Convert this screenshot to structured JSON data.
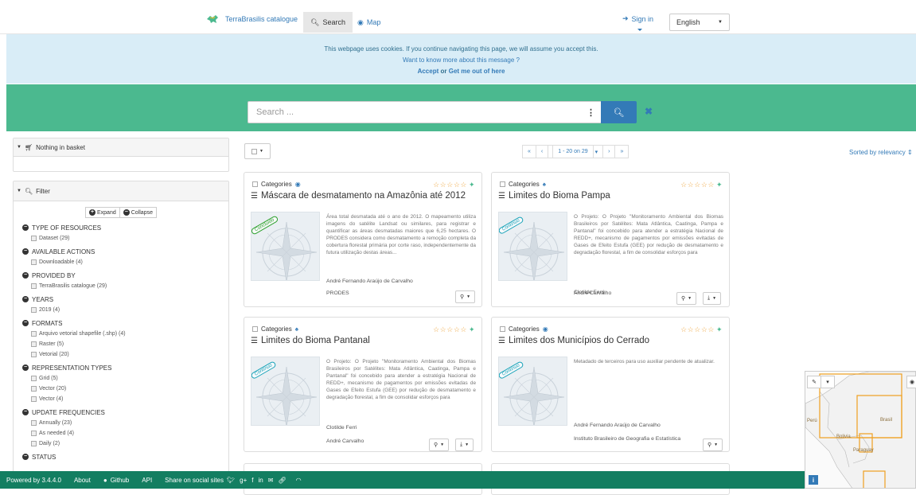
{
  "nav": {
    "brand": "TerraBrasilis catalogue",
    "search_tab": "Search",
    "map_tab": "Map",
    "sign_in": "Sign in",
    "language": "English"
  },
  "cookie": {
    "line1": "This webpage uses cookies. If you continue navigating this page, we will assume you accept this.",
    "line2": "Want to know more about this message ?",
    "accept": "Accept",
    "or": "or",
    "opt_out": "Get me out of here"
  },
  "search": {
    "placeholder": "Search ...",
    "options_glyph": "⋮",
    "clear_glyph": "✖"
  },
  "basket": {
    "label": "Nothing in basket"
  },
  "filter": {
    "label": "Filter",
    "expand": "Expand",
    "collapse": "Collapse",
    "groups": [
      {
        "title": "TYPE OF RESOURCES",
        "items": [
          "Dataset (29)"
        ]
      },
      {
        "title": "AVAILABLE ACTIONS",
        "items": [
          "Downloadable (4)"
        ]
      },
      {
        "title": "PROVIDED BY",
        "items": [
          "TerraBrasilis catalogue (29)"
        ]
      },
      {
        "title": "YEARS",
        "items": [
          "2019 (4)"
        ]
      },
      {
        "title": "FORMATS",
        "items": [
          "Arquivo vetorial shapefile (.shp) (4)",
          "Raster (5)",
          "Vetorial (20)"
        ]
      },
      {
        "title": "REPRESENTATION TYPES",
        "items": [
          "Grid (5)",
          "Vector (20)",
          "Vector (4)"
        ]
      },
      {
        "title": "UPDATE FREQUENCIES",
        "items": [
          "Annually (23)",
          "As needed (4)",
          "Daily (2)"
        ]
      },
      {
        "title": "STATUS",
        "items": []
      }
    ]
  },
  "toolbar": {
    "pager_first": "«",
    "pager_prev": "‹",
    "pager_range": "1 - 20 on 29",
    "pager_next": "›",
    "pager_last": "»",
    "sorted": "Sorted by relevancy"
  },
  "cards": [
    {
      "category": "Categories",
      "title": "Máscara de desmatamento na Amazônia até 2012",
      "stamp": "Concluído",
      "description": "Área total desmatada até o ano de 2012. O mapeamento utiliza imagens do satélite Landsat ou similares, para registrar e quantificar as áreas desmatadas maiores que 6,25 hectares. O PRODES considera como desmatamento a remoção completa da cobertura florestal primária por corte raso, independentemente da futura utilização destas áreas...",
      "author": "André Fernando Araújo de Carvalho",
      "org": "PRODES"
    },
    {
      "category": "Categories",
      "title": "Limites do Bioma Pampa",
      "stamp": "Contínuo",
      "description": "O Projeto: O Projeto \"Monitoramento Ambiental dos Biomas Brasileiros por Satélites: Mata Atlântica, Caatinga, Pampa e Pantanal\" foi concebido para atender a estratégia Nacional de REDD+, mecanismo de pagamentos por emissões evitadas de Gases de Efeito Estufa (GEE) por redução de desmatamento e degradação florestal, a fim de consolidar esforços para",
      "author": "Clotilde Ferri",
      "org": "André Carvalho"
    },
    {
      "category": "Categories",
      "title": "Limites do Bioma Pantanal",
      "stamp": "Contínuo",
      "description": "O Projeto: O Projeto \"Monitoramento Ambiental dos Biomas Brasileiros por Satélites: Mata Atlântica, Caatinga, Pampa e Pantanal\" foi concebido para atender a estratégia Nacional de REDD+, mecanismo de pagamentos por emissões evitadas de Gases de Efeito Estufa (GEE) por redução de desmatamento e degradação florestal, a fim de consolidar esforços para",
      "author": "Clotilde Ferri",
      "org": "André Carvalho"
    },
    {
      "category": "Categories",
      "title": "Limites dos Municípios do Cerrado",
      "stamp": "Contínuo",
      "description": "Metadado de terceiros para uso auxiliar pendente de atualizar.",
      "author": "André Fernando Araújo de Carvalho",
      "org": "Instituto Brasileiro de Geografia e Estatística"
    }
  ],
  "map": {
    "labels": [
      "Perú",
      "Brasil",
      "Bolivia",
      "Paraguay"
    ],
    "info": "i",
    "accent": "#f0a020"
  },
  "footer": {
    "powered": "Powered by 3.4.4.0",
    "about": "About",
    "github": "Github",
    "api": "API",
    "share": "Share on social sites"
  },
  "colors": {
    "band": "#4bb98f",
    "footer": "#137e61",
    "link": "#337ab7",
    "cookie_bg": "#d9edf7"
  }
}
